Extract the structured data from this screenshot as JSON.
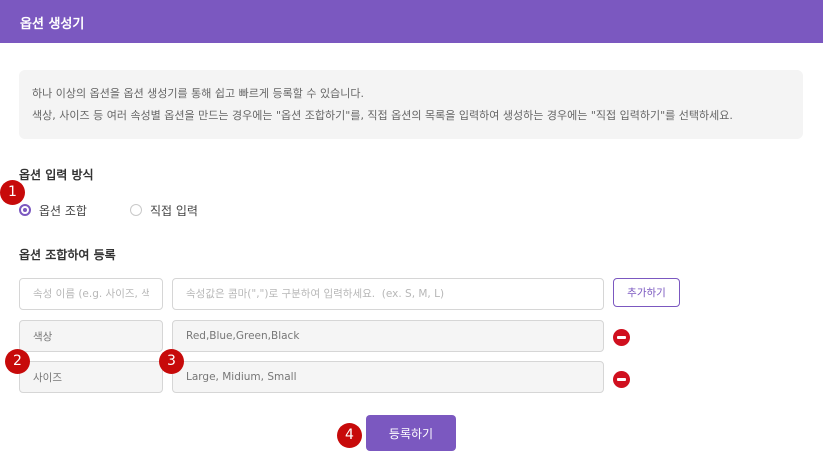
{
  "dialog": {
    "title": "옵션 생성기"
  },
  "info": {
    "line1": "하나 이상의 옵션을 옵션 생성기를 통해 쉽고 빠르게 등록할 수 있습니다.",
    "line2": "색상, 사이즈 등 여러 속성별 옵션을 만드는 경우에는 \"옵션 조합하기\"를, 직접 옵션의 목록을 입력하여 생성하는 경우에는 \"직접 입력하기\"를 선택하세요."
  },
  "input_method": {
    "title": "옵션 입력 방식",
    "options": [
      {
        "label": "옵션 조합",
        "selected": true
      },
      {
        "label": "직접 입력",
        "selected": false
      }
    ]
  },
  "combination": {
    "title": "옵션 조합하여 등록",
    "name_placeholder": "속성 이름 (e.g. 사이즈, 색상)",
    "values_placeholder": "속성값은 콤마(\",\")로 구분하여 입력하세요.  (ex. S, M, L)",
    "add_label": "추가하기",
    "rows": [
      {
        "name": "색상",
        "values": "Red,Blue,Green,Black"
      },
      {
        "name": "사이즈",
        "values": "Large, Midium, Small"
      }
    ]
  },
  "submit_label": "등록하기",
  "annotations": [
    "1",
    "2",
    "3",
    "4"
  ],
  "colors": {
    "accent": "#7b58c0",
    "remove": "#d0101f",
    "badge": "#c70a0a"
  }
}
